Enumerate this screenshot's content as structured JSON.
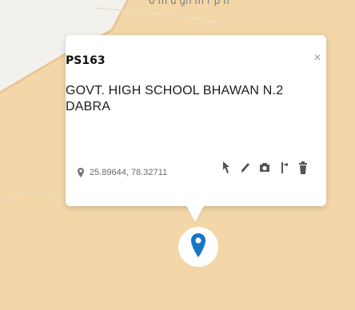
{
  "map": {
    "top_label": "0 m u gn m r p h",
    "colors": {
      "base": "#f3f1ee",
      "area": "#f3d7a9",
      "area_edge": "#e8c794",
      "marker": "#1677c8"
    }
  },
  "popup": {
    "code": "PS163",
    "name": "GOVT. HIGH SCHOOL BHAWAN N.2 DABRA",
    "coordinates": "25.89644, 78.32711",
    "close_glyph": "×",
    "actions": [
      "navigate-icon",
      "pencil-icon",
      "camera-icon",
      "route-icon",
      "trash-icon"
    ]
  }
}
